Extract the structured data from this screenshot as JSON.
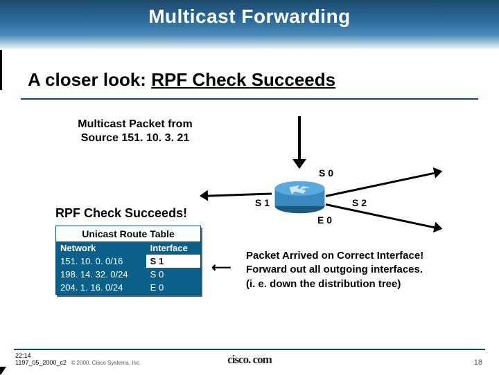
{
  "header": {
    "title": "Multicast Forwarding"
  },
  "subtitle": {
    "prefix": "A closer look: ",
    "emph": "RPF Check Succeeds"
  },
  "packet_label": {
    "line1": "Multicast Packet from",
    "line2": "Source 151. 10. 3. 21"
  },
  "interfaces": {
    "s0": "S 0",
    "s1": "S 1",
    "s2": "S 2",
    "e0": "E 0"
  },
  "succeeds_label": "RPF Check Succeeds!",
  "table": {
    "title": "Unicast Route Table",
    "headers": {
      "network": "Network",
      "interface": "Interface"
    },
    "rows": [
      {
        "network": "151. 10. 0. 0/16",
        "interface": "S 1"
      },
      {
        "network": "198. 14. 32. 0/24",
        "interface": "S 0"
      },
      {
        "network": "204. 1. 16. 0/24",
        "interface": "E 0"
      }
    ]
  },
  "conclusion": {
    "line1": "Packet Arrived on Correct Interface!",
    "line2": "Forward out all outgoing interfaces.",
    "line3": "(i. e. down the distribution tree)"
  },
  "footer": {
    "time": "22:14",
    "docid": "1197_05_2000_c2",
    "copyright": "© 2000, Cisco Systems, Inc.",
    "logo": "cisco. com",
    "page": "18"
  }
}
